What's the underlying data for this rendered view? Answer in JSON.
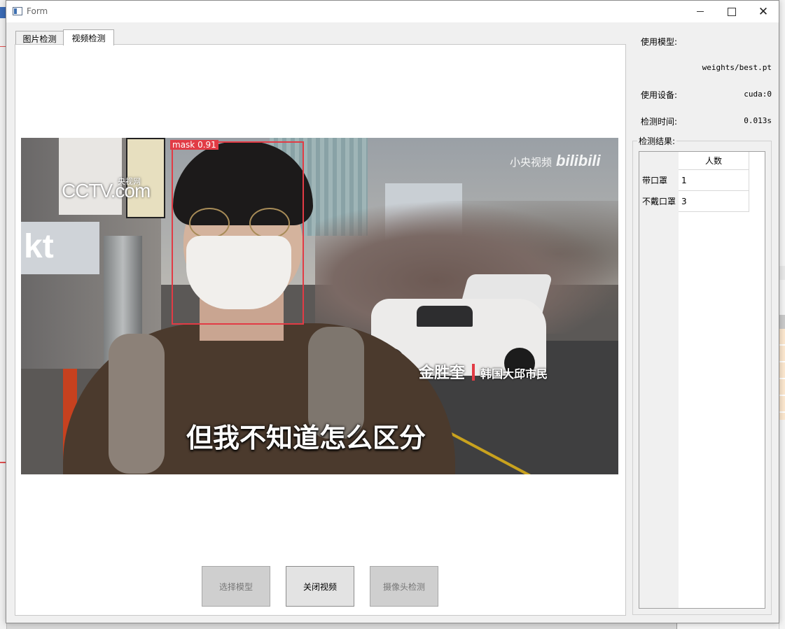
{
  "window": {
    "title": "Form"
  },
  "tabs": [
    {
      "label": "图片检测",
      "active": false
    },
    {
      "label": "视频检测",
      "active": true
    }
  ],
  "video": {
    "detection": {
      "label": "mask",
      "score": "0.91",
      "box_color": "#e23b45"
    },
    "overlay": {
      "channel_logo_text": "CCTV.com",
      "channel_logo_small": "央视网",
      "watermark_text": "小央视频",
      "watermark_logo": "bilibili",
      "speaker_name": "金胜奎",
      "speaker_role": "韩国大邱市民",
      "subtitle": "但我不知道怎么区分",
      "store_sign": "kt"
    }
  },
  "buttons": {
    "select_model": {
      "label": "选择模型",
      "enabled": false
    },
    "close_video": {
      "label": "关闭视频",
      "enabled": true
    },
    "camera_detect": {
      "label": "摄像头检测",
      "enabled": false
    }
  },
  "info": {
    "model_label": "使用模型:",
    "model_value": "weights/best.pt",
    "device_label": "使用设备:",
    "device_value": "cuda:0",
    "time_label": "检测时间:",
    "time_value": "0.013s"
  },
  "results": {
    "title": "检测结果:",
    "column_header": "人数",
    "rows": [
      {
        "label": "带口罩",
        "count": "1"
      },
      {
        "label": "不戴口罩",
        "count": "3"
      }
    ]
  },
  "colors": {
    "accent_red": "#e23b45",
    "window_bg": "#f0f0f0",
    "disabled_button": "#cfcfcf"
  }
}
